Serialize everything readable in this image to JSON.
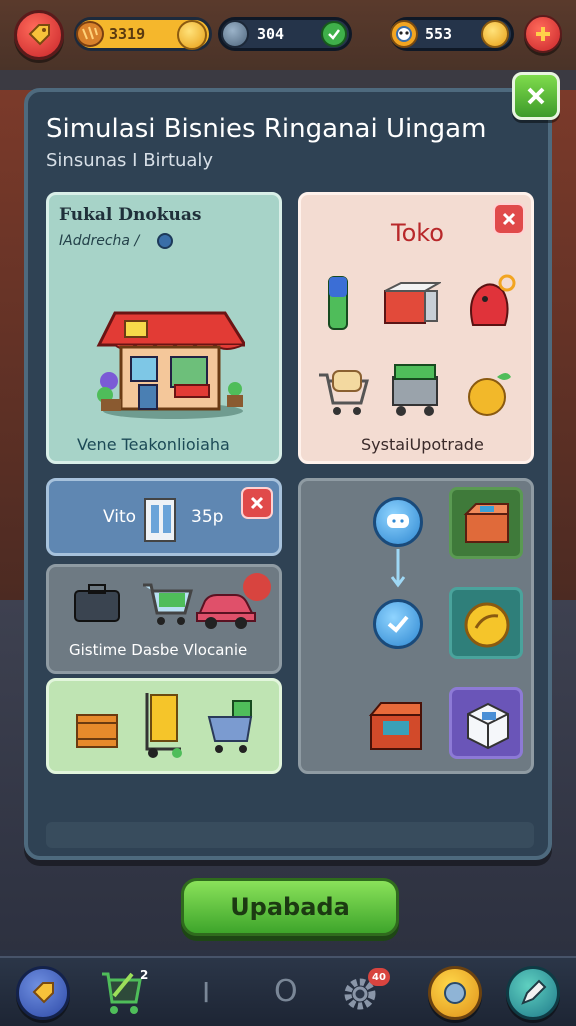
{
  "top_bar": {
    "currency_gold": "3319",
    "currency_gems": "304",
    "currency_coins": "553",
    "colors": {
      "gold_pill": "#f5b72c",
      "dark_pill": "#25344a",
      "accent_red": "#e04646"
    }
  },
  "panel": {
    "title": "Simulasi Bisnies Ringanai Uingam",
    "subtitle": "Sinsunas I Birtualy"
  },
  "card_store": {
    "title": "Fukal Dnokuas",
    "subtitle": "IAddrecha /",
    "footer": "Vene Teakonlioiaha"
  },
  "card_toko": {
    "title": "Toko",
    "footer": "SystaiUpotrade"
  },
  "card_price": {
    "prefix": "Vito",
    "value": "35p"
  },
  "card_vehicles": {
    "footer": "Gistime Dasbe Vlocanie"
  },
  "footer_button": {
    "label": "Upabada"
  },
  "nav": {
    "cart_badge": "2",
    "gear_badge": "40",
    "pipe_glyph": "I",
    "ring_glyph": "O"
  }
}
